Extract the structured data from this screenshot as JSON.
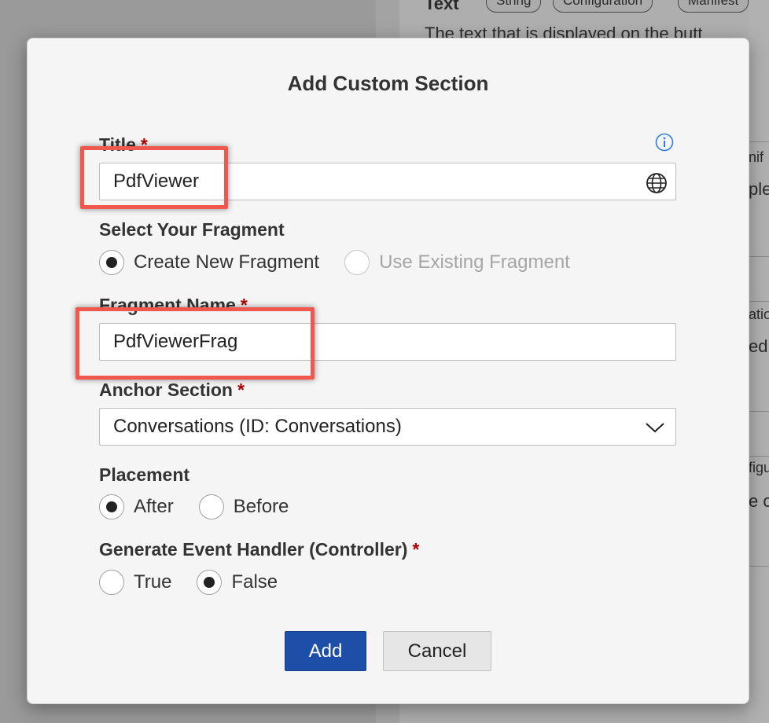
{
  "background": {
    "section_label": "Text",
    "tags": [
      "String",
      "Configuration",
      "Manifest"
    ],
    "description": "The text that is displayed on the butt",
    "side_fragments": [
      "nif",
      "ple",
      "atio",
      "ed",
      "figu",
      "e c"
    ]
  },
  "dialog": {
    "title": "Add Custom Section",
    "title_field": {
      "label": "Title",
      "required_mark": "*",
      "value": "PdfViewer"
    },
    "fragment_choice": {
      "label": "Select Your Fragment",
      "options": [
        {
          "label": "Create New Fragment",
          "selected": true,
          "disabled": false
        },
        {
          "label": "Use Existing Fragment",
          "selected": false,
          "disabled": true
        }
      ]
    },
    "fragment_name": {
      "label": "Fragment Name",
      "required_mark": "*",
      "value": "PdfViewerFrag"
    },
    "anchor_section": {
      "label": "Anchor Section",
      "required_mark": "*",
      "value": "Conversations (ID: Conversations)"
    },
    "placement": {
      "label": "Placement",
      "options": [
        {
          "label": "After",
          "selected": true
        },
        {
          "label": "Before",
          "selected": false
        }
      ]
    },
    "event_handler": {
      "label": "Generate Event Handler (Controller)",
      "required_mark": "*",
      "options": [
        {
          "label": "True",
          "selected": false
        },
        {
          "label": "False",
          "selected": true
        }
      ]
    },
    "buttons": {
      "add": "Add",
      "cancel": "Cancel"
    }
  },
  "icons": {
    "info": "info-icon",
    "globe": "globe-icon",
    "dropdown": "chevron-down-icon"
  },
  "colors": {
    "primary_button": "#1d4fa8",
    "required": "#b00000",
    "highlight": "#f0584d",
    "info": "#2f7de1"
  }
}
